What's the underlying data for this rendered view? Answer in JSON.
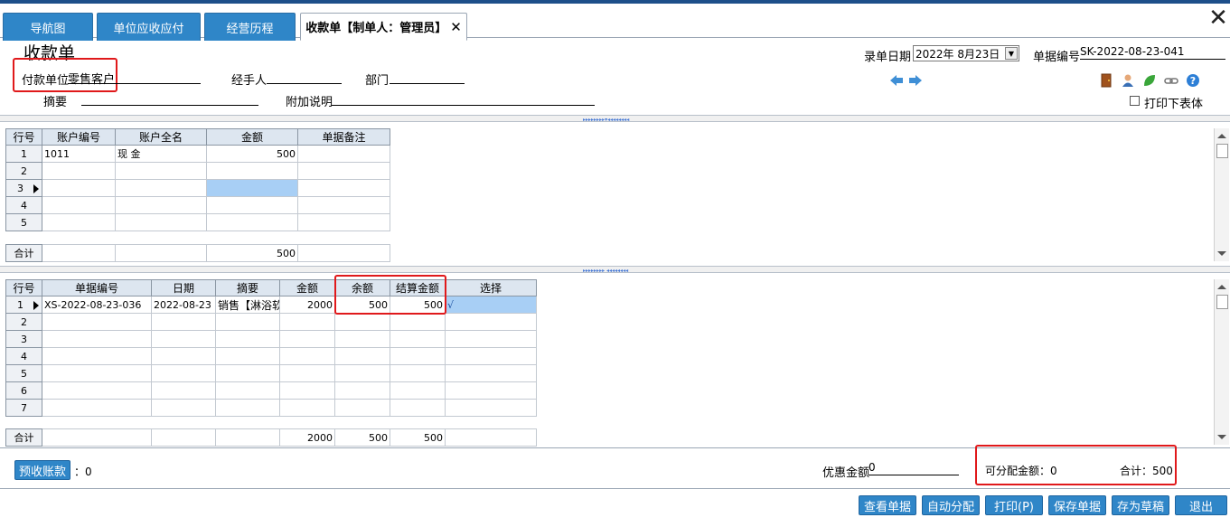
{
  "tabs": [
    {
      "label": "导航图"
    },
    {
      "label": "单位应收应付"
    },
    {
      "label": "经营历程"
    },
    {
      "label": "收款单【制单人：管理员】"
    }
  ],
  "header": {
    "title": "收款单",
    "payer_label": "付款单位",
    "payer_value": "零售客户",
    "handler_label": "经手人",
    "dept_label": "部门",
    "summary_label": "摘要",
    "note_label": "附加说明",
    "date_label": "录单日期",
    "date_value": "2022年  8月23日",
    "docno_label": "单据编号",
    "docno_value": "SK-2022-08-23-041",
    "print_lower_label": "打印下表体"
  },
  "upper_grid": {
    "headers": [
      "行号",
      "账户编号",
      "账户全名",
      "金额",
      "单据备注"
    ],
    "rows": [
      {
        "no": "1",
        "code": "1011",
        "name": "现      金",
        "amount": "500",
        "remark": ""
      },
      {
        "no": "2",
        "code": "",
        "name": "",
        "amount": "",
        "remark": ""
      },
      {
        "no": "3",
        "code": "",
        "name": "",
        "amount": "",
        "remark": ""
      },
      {
        "no": "4",
        "code": "",
        "name": "",
        "amount": "",
        "remark": ""
      },
      {
        "no": "5",
        "code": "",
        "name": "",
        "amount": "",
        "remark": ""
      }
    ],
    "total_label": "合计",
    "total_amount": "500"
  },
  "lower_grid": {
    "headers": [
      "行号",
      "单据编号",
      "日期",
      "摘要",
      "金额",
      "余额",
      "结算金额",
      "选择"
    ],
    "rows": [
      {
        "no": "1",
        "docno": "XS-2022-08-23-036",
        "date": "2022-08-23",
        "summary": "销售【淋浴软",
        "amount": "2000",
        "balance": "500",
        "settle": "500",
        "select": "√"
      },
      {
        "no": "2",
        "docno": "",
        "date": "",
        "summary": "",
        "amount": "",
        "balance": "",
        "settle": "",
        "select": ""
      },
      {
        "no": "3",
        "docno": "",
        "date": "",
        "summary": "",
        "amount": "",
        "balance": "",
        "settle": "",
        "select": ""
      },
      {
        "no": "4",
        "docno": "",
        "date": "",
        "summary": "",
        "amount": "",
        "balance": "",
        "settle": "",
        "select": ""
      },
      {
        "no": "5",
        "docno": "",
        "date": "",
        "summary": "",
        "amount": "",
        "balance": "",
        "settle": "",
        "select": ""
      },
      {
        "no": "6",
        "docno": "",
        "date": "",
        "summary": "",
        "amount": "",
        "balance": "",
        "settle": "",
        "select": ""
      },
      {
        "no": "7",
        "docno": "",
        "date": "",
        "summary": "",
        "amount": "",
        "balance": "",
        "settle": "",
        "select": ""
      }
    ],
    "total_label": "合计",
    "total_amount": "2000",
    "total_balance": "500",
    "total_settle": "500"
  },
  "footer": {
    "prepaid_button": "预收账款",
    "prepaid_value": "：0",
    "discount_label": "优惠金额",
    "discount_value": "0",
    "allocatable_label": "可分配金额：0",
    "total_label": "合计：500"
  },
  "buttons": {
    "view": "查看单据",
    "auto": "自动分配",
    "print": "打印(P)",
    "save": "保存单据",
    "draft": "存为草稿",
    "exit": "退出"
  },
  "icons": [
    "door-icon",
    "user-icon",
    "leaf-icon",
    "link-icon",
    "help-icon",
    "arrow-left-icon",
    "arrow-right-icon"
  ],
  "colors": {
    "accent": "#2f86c8",
    "highlight": "#e0191b",
    "selection": "#a8cff5"
  }
}
